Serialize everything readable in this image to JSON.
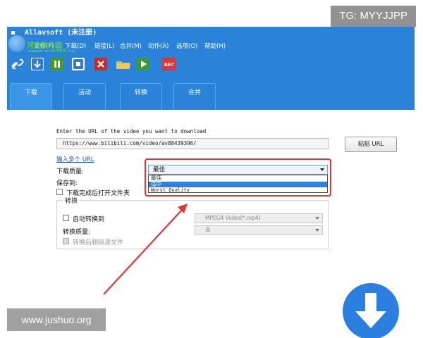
{
  "watermarks": {
    "tg_badge": "TG: MYYJJPP",
    "bottom_site": "www.jushuo.org",
    "overlay_cn": "河东软件园",
    "overlay_site": "www.pc0359.cn"
  },
  "window": {
    "title": "Allavsoft (未注册)"
  },
  "menu": {
    "items": [
      "文件(F)",
      "下载(D)",
      "链接(L)",
      "合并(M)",
      "动作(A)",
      "选项(O)",
      "帮助(H)"
    ]
  },
  "toolbar": {
    "buttons": [
      {
        "icon": "link-icon",
        "color": "#ffffff"
      },
      {
        "icon": "download-arrow-icon",
        "color": "#2e7cd6"
      },
      {
        "icon": "pause-icon",
        "color": "#4a9a1a"
      },
      {
        "icon": "stop-icon",
        "color": "#2e7cd6"
      },
      {
        "icon": "delete-x-icon",
        "color": "#c42a2a"
      },
      {
        "icon": "folder-icon",
        "color": "#e8b23a"
      },
      {
        "icon": "play-icon",
        "color": "#3a9a3a"
      },
      {
        "icon": "record-icon",
        "color": "#d83a3a",
        "label": "REC"
      }
    ]
  },
  "tabs": [
    {
      "label": "下载",
      "active": true
    },
    {
      "label": "活动",
      "active": false
    },
    {
      "label": "转换",
      "active": false
    },
    {
      "label": "合并",
      "active": false
    }
  ],
  "download": {
    "url_prompt": "Enter the URL of the video you want to download",
    "url_value": "https://www.bilibili.com/video/av88439396/",
    "paste_button": "粘贴 URL",
    "multi_url_link": "输入多个 URL",
    "quality_label": "下载质量:",
    "quality_selected": "最佳",
    "quality_options": [
      "最佳",
      "适中",
      "Worst Quality"
    ],
    "quality_highlighted_index": 1,
    "save_to_label": "保存到:",
    "open_folder_label": "下载完成后打开文件夹"
  },
  "convert": {
    "group_title": "转换",
    "auto_convert_label": "自动转换到",
    "format_value": "MPEG4 Video(*.mp4)",
    "convert_quality_label": "转换质量:",
    "convert_quality_value": "高",
    "delete_source_label": "转换后删除源文件"
  },
  "colors": {
    "window_blue": "#2a83d9",
    "highlight_blue": "#2d80e0",
    "annotation_red": "#e13535",
    "download_circle": "#2a7fe0"
  }
}
